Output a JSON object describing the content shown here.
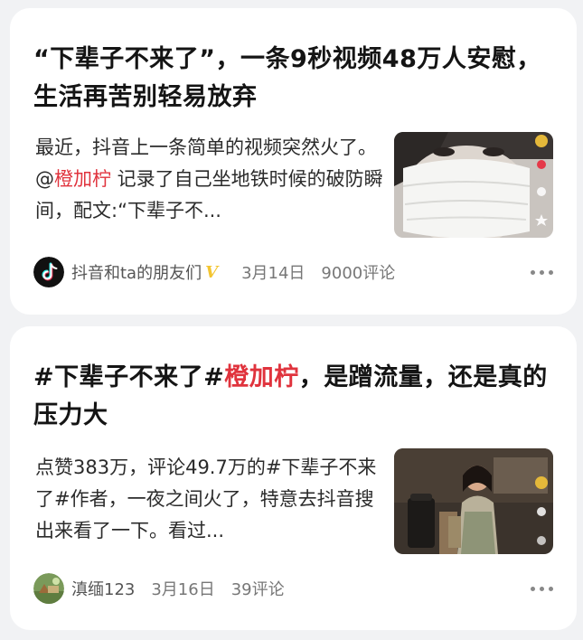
{
  "articles": [
    {
      "title": "“下辈子不来了”，一条9秒视频48万人安慰，生活再苦别轻易放弃",
      "snippet_before": "最近，抖音上一条简单的视频突然火了。@",
      "mention": "橙加柠",
      "snippet_after": " 记录了自己坐地铁时候的破防瞬间，配文:“下辈子不...",
      "source": "抖音和ta的朋友们",
      "verified_mark": "V",
      "date": "3月14日",
      "comments": "9000评论",
      "thumbnail_icon": "masked-face-video-thumbnail",
      "accent_color": "#e0333d"
    },
    {
      "title_before": "#下辈子不来了#",
      "title_hashtag": "橙加柠",
      "title_after": "，是蹭流量，还是真的压力大",
      "snippet": "点赞383万，评论49.7万的#下辈子不来了#作者，一夜之间火了，特意去抖音搜出来看了一下。看过...",
      "source": "滇缅123",
      "date": "3月16日",
      "comments": "39评论",
      "thumbnail_icon": "cafe-person-video-thumbnail"
    }
  ]
}
